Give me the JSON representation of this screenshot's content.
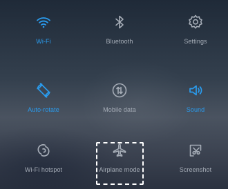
{
  "quick_settings": {
    "tiles": [
      {
        "label": "Wi-Fi",
        "icon": "wifi-icon",
        "active": true
      },
      {
        "label": "Bluetooth",
        "icon": "bluetooth-icon",
        "active": false
      },
      {
        "label": "Settings",
        "icon": "gear-icon",
        "active": false
      },
      {
        "label": "Auto-rotate",
        "icon": "auto-rotate-icon",
        "active": true
      },
      {
        "label": "Mobile data",
        "icon": "mobile-data-icon",
        "active": false
      },
      {
        "label": "Sound",
        "icon": "speaker-icon",
        "active": true
      },
      {
        "label": "Wi-Fi hotspot",
        "icon": "hotspot-icon",
        "active": false
      },
      {
        "label": "Airplane mode",
        "icon": "airplane-icon",
        "active": false
      },
      {
        "label": "Screenshot",
        "icon": "screenshot-icon",
        "active": false
      }
    ]
  },
  "colors": {
    "active": "#2a9df0",
    "inactive": "#a6adb7",
    "highlight": "#ffffff"
  }
}
